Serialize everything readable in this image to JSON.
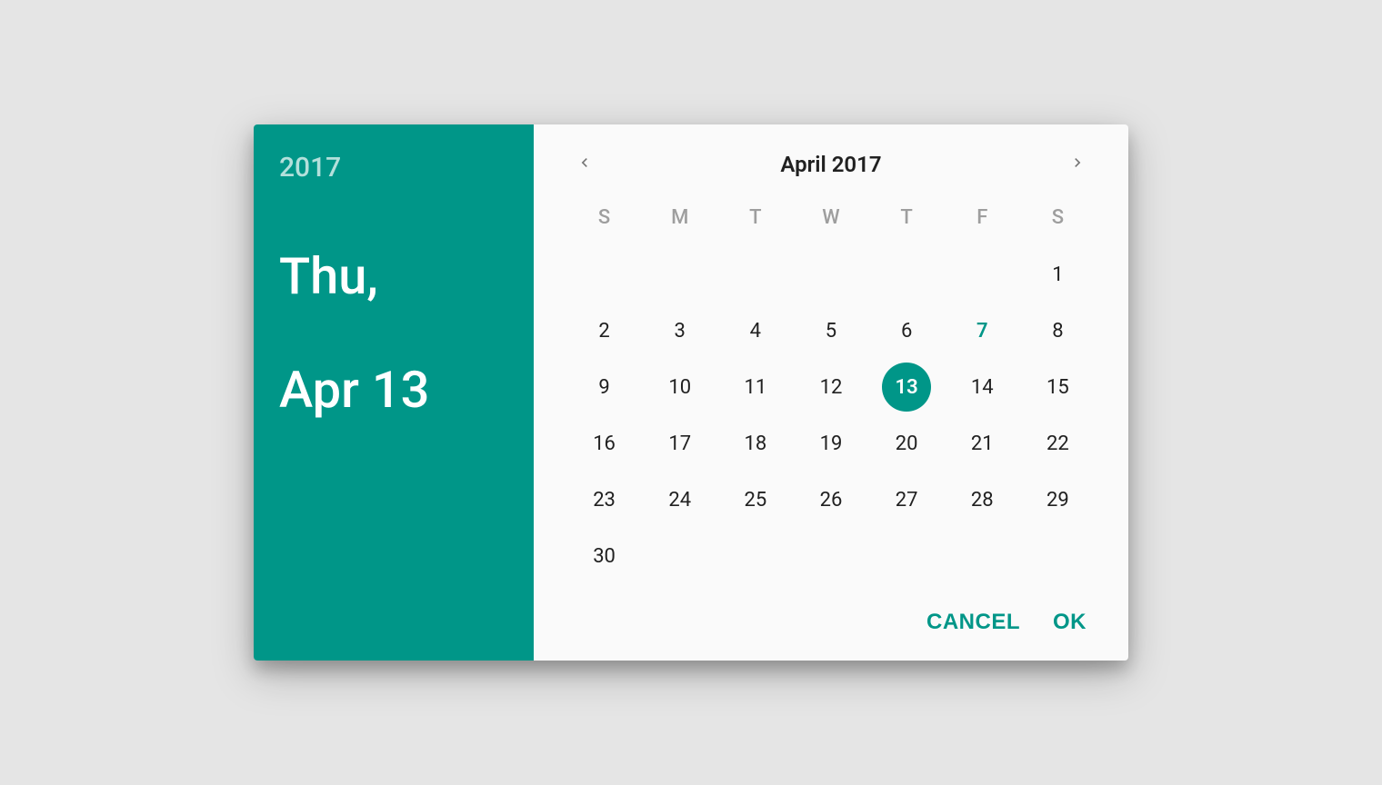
{
  "panel": {
    "year": "2017",
    "date_line1": "Thu,",
    "date_line2": "Apr 13"
  },
  "calendar": {
    "month_title": "April 2017",
    "dow": [
      "S",
      "M",
      "T",
      "W",
      "T",
      "F",
      "S"
    ],
    "leading_blanks": 6,
    "days_in_month": 30,
    "today": 7,
    "selected": 13
  },
  "actions": {
    "cancel": "CANCEL",
    "ok": "OK"
  },
  "colors": {
    "accent": "#009688"
  }
}
